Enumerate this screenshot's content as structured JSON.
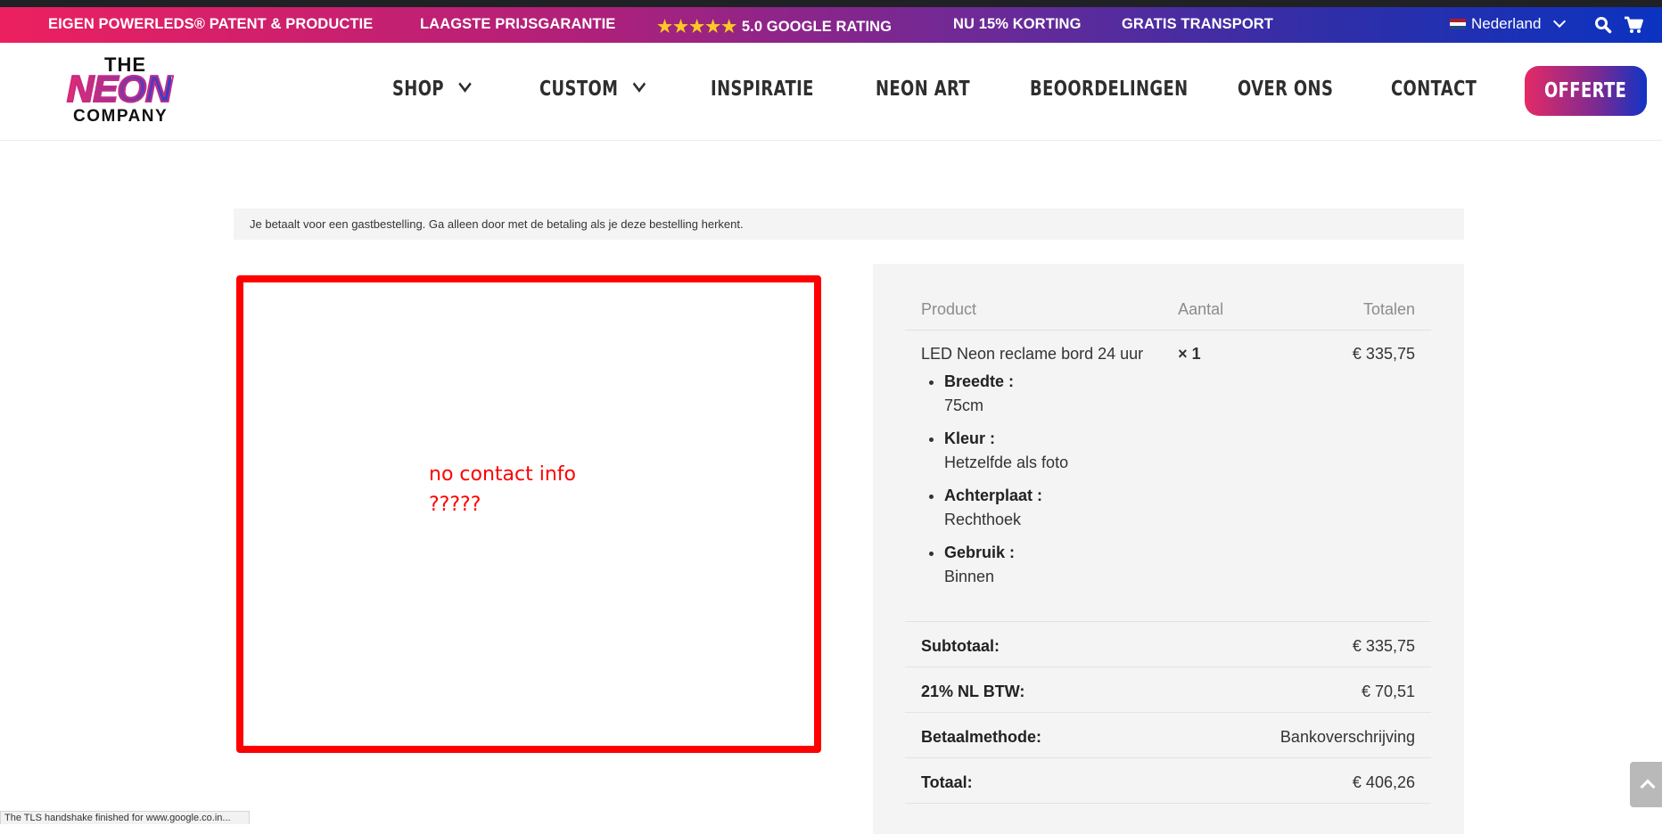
{
  "topbar": {
    "items": [
      "EIGEN POWERLEDS® PATENT & PRODUCTIE",
      "LAAGSTE PRIJSGARANTIE",
      "5.0 GOOGLE RATING",
      "NU 15% KORTING",
      "GRATIS TRANSPORT"
    ],
    "stars": "★★★★★",
    "rating_stars": 5,
    "language": "Nederland",
    "icons": [
      "netherlands-flag-icon",
      "chevron-down-icon",
      "search-icon",
      "cart-icon"
    ]
  },
  "header": {
    "logo": {
      "line1": "THE",
      "line2": "NEON",
      "line3": "COMPANY"
    },
    "nav": [
      {
        "label": "SHOP",
        "has_dropdown": true
      },
      {
        "label": "CUSTOM",
        "has_dropdown": true
      },
      {
        "label": "INSPIRATIE",
        "has_dropdown": false
      },
      {
        "label": "NEON ART",
        "has_dropdown": false
      },
      {
        "label": "BEOORDELINGEN",
        "has_dropdown": false
      },
      {
        "label": "OVER ONS",
        "has_dropdown": false
      },
      {
        "label": "CONTACT",
        "has_dropdown": false
      }
    ],
    "cta_label": "OFFERTE"
  },
  "notice": "Je betaalt voor een gastbestelling. Ga alleen door met de betaling als je deze bestelling herkent.",
  "annotation": {
    "line1": "no contact info",
    "line2": "?????"
  },
  "order": {
    "columns": [
      "Product",
      "Aantal",
      "Totalen"
    ],
    "items": [
      {
        "name": "LED Neon reclame bord 24 uur",
        "quantity": "× 1",
        "total": "€ 335,75",
        "meta": [
          {
            "key": "Breedte :",
            "value": "75cm"
          },
          {
            "key": "Kleur :",
            "value": "Hetzelfde als foto"
          },
          {
            "key": "Achterplaat :",
            "value": "Rechthoek"
          },
          {
            "key": "Gebruik :",
            "value": "Binnen"
          }
        ]
      }
    ],
    "totals": [
      {
        "label": "Subtotaal:",
        "value": "€ 335,75"
      },
      {
        "label": "21% NL BTW:",
        "value": "€ 70,51"
      },
      {
        "label": "Betaalmethode:",
        "value": "Bankoverschrijving"
      },
      {
        "label": "Totaal:",
        "value": "€ 406,26"
      }
    ]
  },
  "statusbar": "The TLS handshake finished for www.google.co.in...",
  "colors": {
    "gradient_start": "#ec2060",
    "gradient_end": "#0b33c0",
    "annotation_red": "#ff0000",
    "panel_bg": "#f4f4f4"
  }
}
